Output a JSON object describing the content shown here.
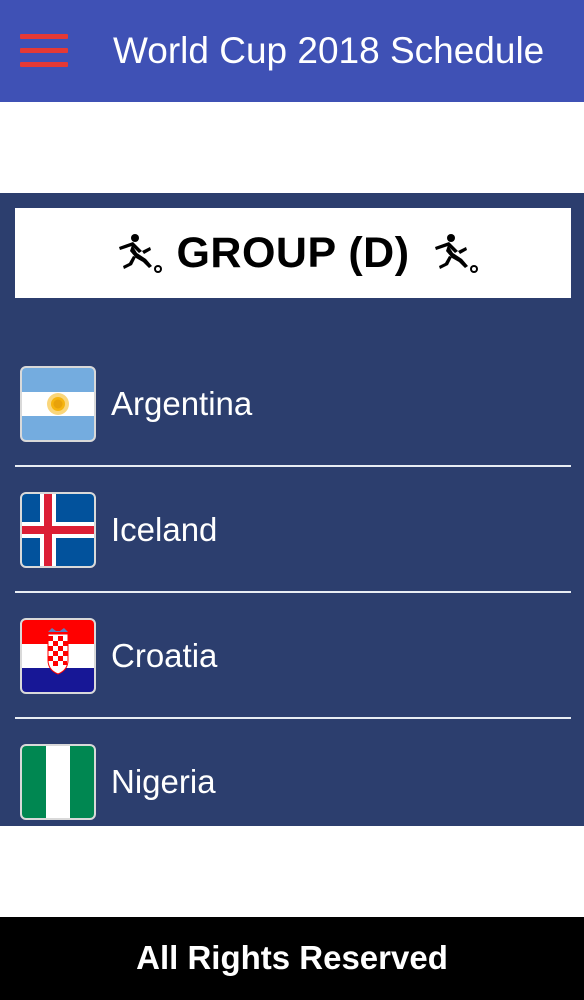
{
  "app_bar": {
    "title": "World Cup 2018 Schedule",
    "menu_icon": "hamburger-menu-icon",
    "background_color": "#3f51b5",
    "menu_icon_color": "#e53935"
  },
  "group": {
    "title": "GROUP (D)",
    "decor_icon": "soccer-player-icon",
    "panel_color": "#2c3e6e",
    "teams": [
      {
        "name": "Argentina",
        "flag_icon": "argentina-flag-icon"
      },
      {
        "name": "Iceland",
        "flag_icon": "iceland-flag-icon"
      },
      {
        "name": "Croatia",
        "flag_icon": "croatia-flag-icon"
      },
      {
        "name": "Nigeria",
        "flag_icon": "nigeria-flag-icon"
      }
    ]
  },
  "footer": {
    "text": "All Rights Reserved",
    "background_color": "#000000"
  }
}
